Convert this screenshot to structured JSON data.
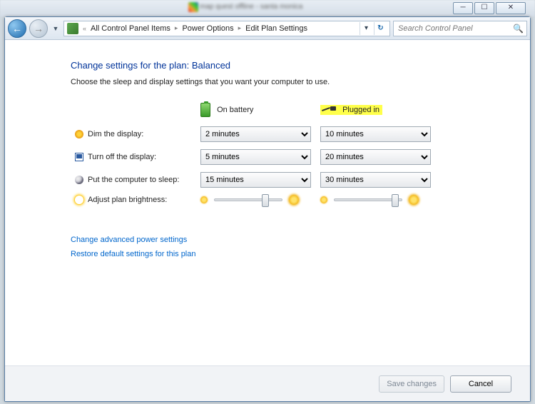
{
  "titlebar": {
    "min_tip": "Minimize",
    "max_tip": "Maximize",
    "close_tip": "Close",
    "blurred_tab_text": "map quest offline - santa monica"
  },
  "nav": {
    "back_tip": "Back",
    "fwd_tip": "Forward",
    "crumb_chevrons": "«",
    "crumb1": "All Control Panel Items",
    "crumb2": "Power Options",
    "crumb3": "Edit Plan Settings",
    "search_placeholder": "Search Control Panel"
  },
  "page": {
    "heading": "Change settings for the plan: Balanced",
    "subtitle": "Choose the sleep and display settings that you want your computer to use.",
    "col_battery": "On battery",
    "col_plugged": "Plugged in",
    "rows": {
      "dim": {
        "label": "Dim the display:",
        "battery": "2 minutes",
        "plugged": "10 minutes"
      },
      "off": {
        "label": "Turn off the display:",
        "battery": "5 minutes",
        "plugged": "20 minutes"
      },
      "sleep": {
        "label": "Put the computer to sleep:",
        "battery": "15 minutes",
        "plugged": "30 minutes"
      },
      "bright": {
        "label": "Adjust plan brightness:",
        "battery_pct": 70,
        "plugged_pct": 85
      }
    },
    "link_advanced": "Change advanced power settings",
    "link_restore": "Restore default settings for this plan"
  },
  "footer": {
    "save": "Save changes",
    "cancel": "Cancel"
  },
  "highlights": {
    "plugged_header": true,
    "plugged_brightness_slider": true
  }
}
